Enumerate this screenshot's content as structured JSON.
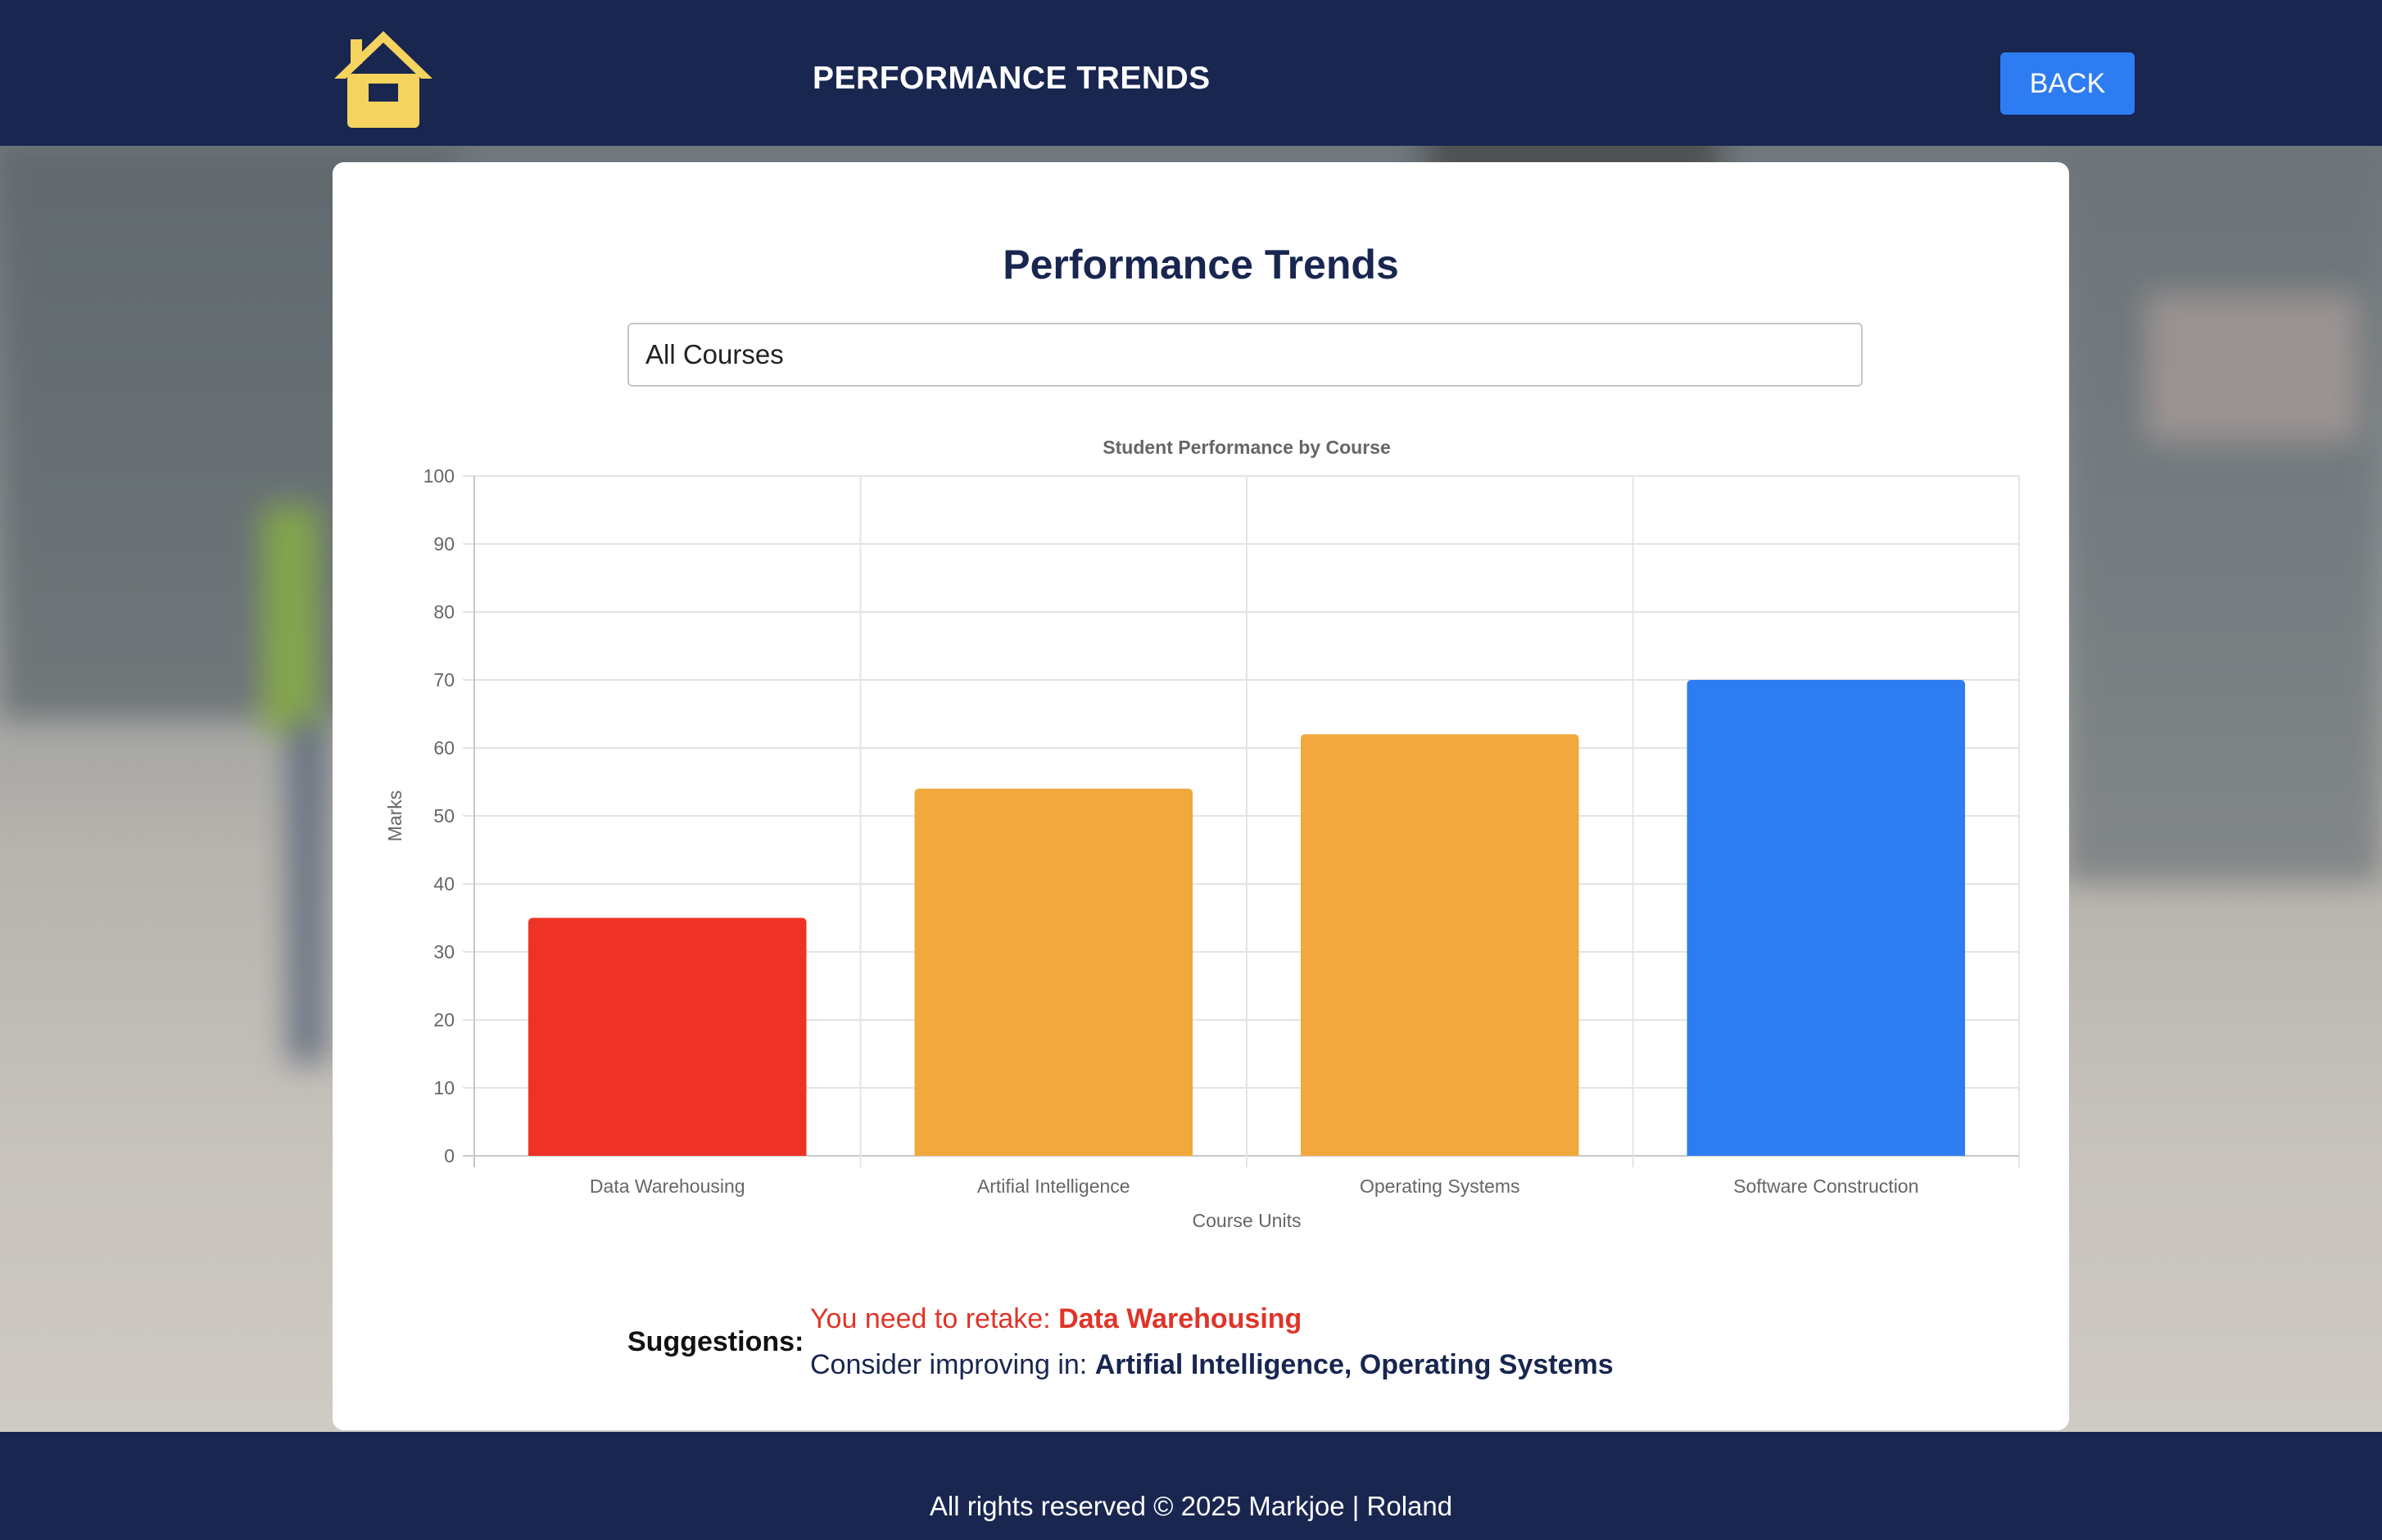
{
  "header": {
    "title": "PERFORMANCE TRENDS",
    "back_label": "BACK"
  },
  "main": {
    "title": "Performance Trends",
    "course_select": {
      "selected": "All Courses"
    }
  },
  "chart_data": {
    "type": "bar",
    "title": "Student Performance by Course",
    "xlabel": "Course Units",
    "ylabel": "Marks",
    "categories": [
      "Data Warehousing",
      "Artifial Intelligence",
      "Operating Systems",
      "Software Construction"
    ],
    "values": [
      35,
      54,
      62,
      70
    ],
    "colors": [
      "#ee3225",
      "#f1a83c",
      "#f1a83c",
      "#2e7cf2"
    ],
    "ylim": [
      0,
      100
    ],
    "yticks": [
      0,
      10,
      20,
      30,
      40,
      50,
      60,
      70,
      80,
      90,
      100
    ],
    "grid": true
  },
  "suggestions": {
    "label": "Suggestions:",
    "retake_prefix": "You need to retake: ",
    "retake_courses": "Data Warehousing",
    "improve_prefix": "Consider improving in: ",
    "improve_courses": "Artifial Intelligence, Operating Systems"
  },
  "footer": {
    "text": "All rights reserved © 2025 Markjoe | Roland"
  },
  "colors": {
    "navy": "#182650",
    "accent_blue": "#2e7cf2",
    "danger_red": "#ee3225",
    "warning_orange": "#f1a83c",
    "home_icon_yellow": "#f4d35e"
  }
}
